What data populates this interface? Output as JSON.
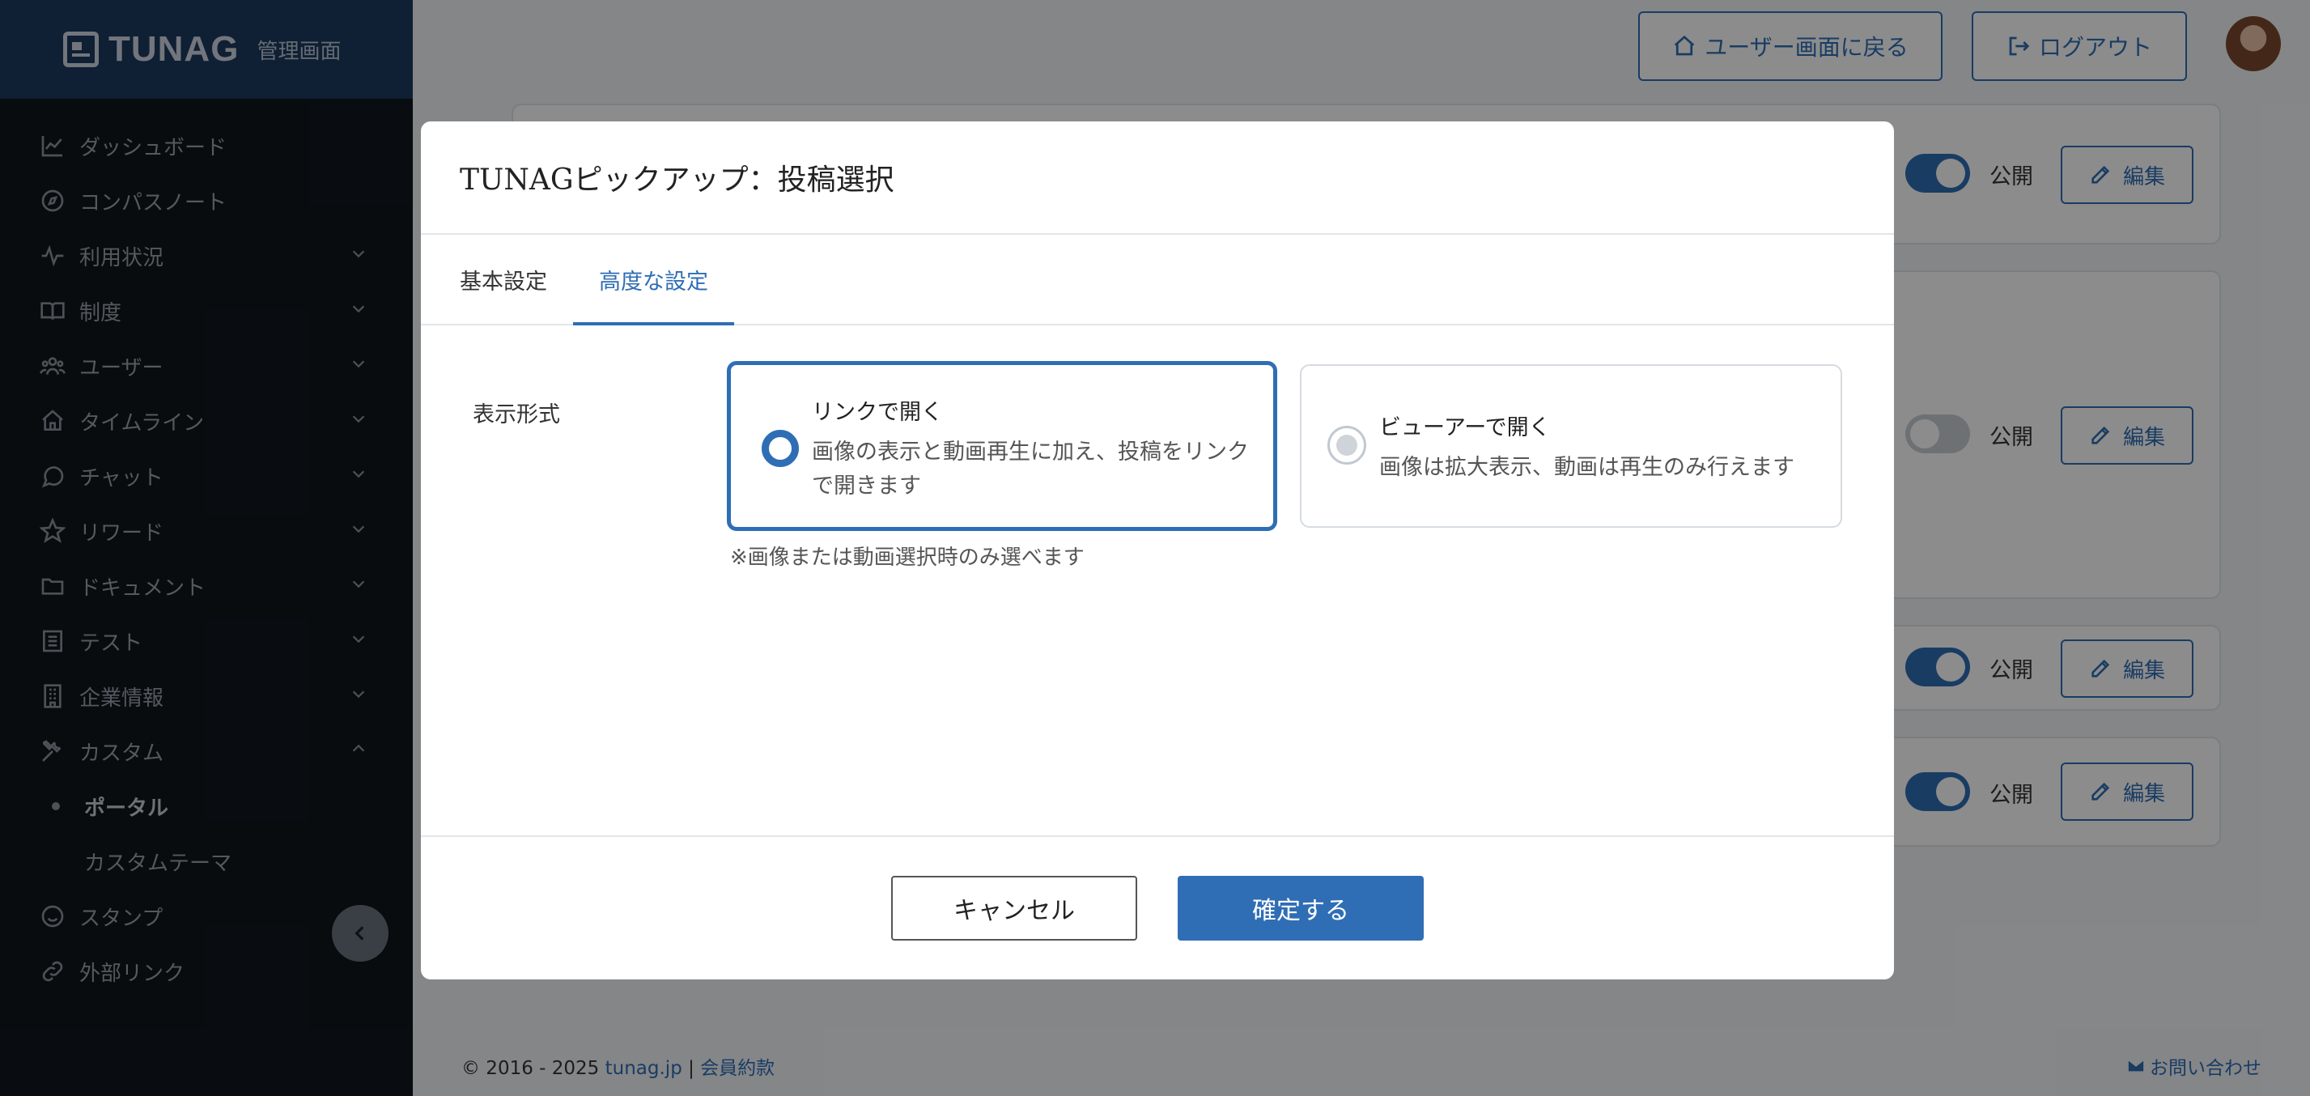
{
  "app": {
    "logo_text": "TUNAG",
    "logo_sub": "管理画面"
  },
  "sidebar": {
    "items": [
      {
        "label": "ダッシュボード",
        "icon": "chart-line-icon"
      },
      {
        "label": "コンパスノート",
        "icon": "compass-icon"
      },
      {
        "label": "利用状況",
        "icon": "activity-icon"
      },
      {
        "label": "制度",
        "icon": "book-icon"
      },
      {
        "label": "ユーザー",
        "icon": "users-icon"
      },
      {
        "label": "タイムライン",
        "icon": "home-icon"
      },
      {
        "label": "チャット",
        "icon": "chat-icon"
      },
      {
        "label": "リワード",
        "icon": "star-icon"
      },
      {
        "label": "ドキュメント",
        "icon": "folder-icon"
      },
      {
        "label": "テスト",
        "icon": "list-icon"
      },
      {
        "label": "企業情報",
        "icon": "building-icon"
      },
      {
        "label": "カスタム",
        "icon": "tools-icon"
      },
      {
        "label": "スタンプ",
        "icon": "smile-icon"
      },
      {
        "label": "外部リンク",
        "icon": "link-icon"
      }
    ],
    "sub_items": [
      {
        "label": "ポータル"
      },
      {
        "label": "カスタムテーマ"
      }
    ]
  },
  "header": {
    "back_label": "ユーザー画面に戻る",
    "logout_label": "ログアウト"
  },
  "cards": {
    "public_label": "公開",
    "edit_label": "編集"
  },
  "footer": {
    "copyright": "© 2016 - 2025",
    "site_link": "tunag.jp",
    "separator": "|",
    "terms_link": "会員約款",
    "contact_label": "お問い合わせ"
  },
  "modal": {
    "title": "TUNAGピックアップ：投稿選択",
    "tabs": [
      {
        "label": "基本設定"
      },
      {
        "label": "高度な設定"
      }
    ],
    "field_label": "表示形式",
    "options": [
      {
        "title": "リンクで開く",
        "desc": "画像の表示と動画再生に加え、投稿をリンクで開きます"
      },
      {
        "title": "ビューアーで開く",
        "desc": "画像は拡大表示、動画は再生のみ行えます"
      }
    ],
    "note": "※画像または動画選択時のみ選べます",
    "cancel_label": "キャンセル",
    "confirm_label": "確定する"
  }
}
